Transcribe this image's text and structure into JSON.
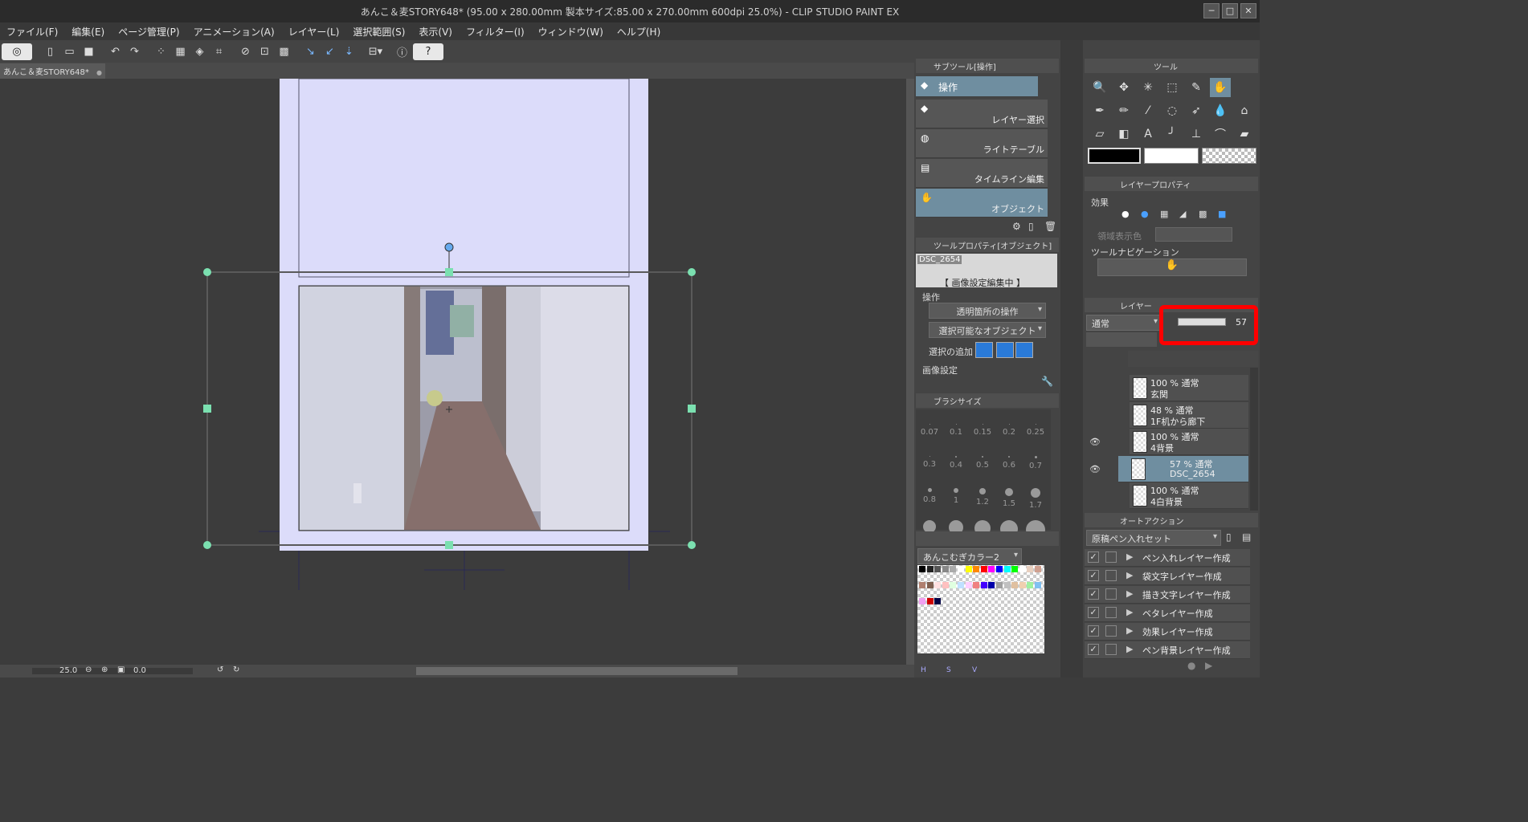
{
  "window": {
    "title": "あんこ＆麦STORY648* (95.00 x 280.00mm 製本サイズ:85.00 x 270.00mm 600dpi 25.0%) - CLIP STUDIO PAINT EX",
    "minimize": "─",
    "maximize": "□",
    "close": "✕"
  },
  "menu": [
    "ファイル(F)",
    "編集(E)",
    "ページ管理(P)",
    "アニメーション(A)",
    "レイヤー(L)",
    "選択範囲(S)",
    "表示(V)",
    "フィルター(I)",
    "ウィンドウ(W)",
    "ヘルプ(H)"
  ],
  "document": {
    "tab_label": "あんこ＆麦STORY648*",
    "tab_close": "●",
    "zoom": "25.0",
    "rotation": "0.0"
  },
  "subtool_panel": {
    "header": "サブツール[操作]",
    "current": "操作",
    "items": [
      {
        "label": "レイヤー選択",
        "selected": false
      },
      {
        "label": "ライトテーブル",
        "selected": false
      },
      {
        "label": "タイムライン編集",
        "selected": false
      },
      {
        "label": "オブジェクト",
        "selected": true
      }
    ]
  },
  "tool_property": {
    "header": "ツールプロパティ[オブジェクト]",
    "object_name": "DSC_2654",
    "editing_banner": "【 画像設定編集中 】",
    "section_operation": "操作",
    "transparent_op": "透明箇所の操作",
    "selectable_objects": "選択可能なオブジェクト",
    "add_selection_label": "選択の追加",
    "section_image": "画像設定"
  },
  "brush_size": {
    "header": "ブラシサイズ",
    "sizes": [
      "0.07",
      "0.1",
      "0.15",
      "0.2",
      "0.25",
      "0.3",
      "0.4",
      "0.5",
      "0.6",
      "0.7",
      "0.8",
      "1",
      "1.2",
      "1.5",
      "1.7",
      "",
      "",
      "",
      "",
      ""
    ]
  },
  "color_set": {
    "name": "あんこむぎカラー2",
    "bottom_labels": [
      "H",
      "S",
      "V"
    ]
  },
  "tools_panel": {
    "header": "ツール"
  },
  "layer_property": {
    "header": "レイヤープロパティ",
    "effect_label": "効果",
    "area_color_label": "領域表示色",
    "tool_nav_label": "ツールナビゲーション"
  },
  "layer_panel": {
    "header": "レイヤー",
    "blend_mode": "通常",
    "opacity": "57",
    "layers": [
      {
        "mode": "100 % 通常",
        "name": "玄関",
        "selected": false,
        "visible": false
      },
      {
        "mode": "48 % 通常",
        "name": "1F机から廊下",
        "selected": false,
        "visible": false
      },
      {
        "mode": "100 % 通常",
        "name": "4背景",
        "selected": false,
        "visible": true
      },
      {
        "mode": "57 % 通常",
        "name": "DSC_2654",
        "selected": true,
        "visible": true
      },
      {
        "mode": "100 % 通常",
        "name": "4白背景",
        "selected": false,
        "visible": false
      }
    ]
  },
  "auto_action": {
    "header": "オートアクション",
    "set_name": "原稿ペン入れセット",
    "items": [
      "ペン入れレイヤー作成",
      "袋文字レイヤー作成",
      "描き文字レイヤー作成",
      "ベタレイヤー作成",
      "効果レイヤー作成",
      "ペン背景レイヤー作成"
    ]
  },
  "colors": {
    "accent_selected": "#6f8ea0",
    "page_tint": "#dcdcfa",
    "handle": "#7be0b0",
    "highlight_annotation": "#ff0000"
  }
}
